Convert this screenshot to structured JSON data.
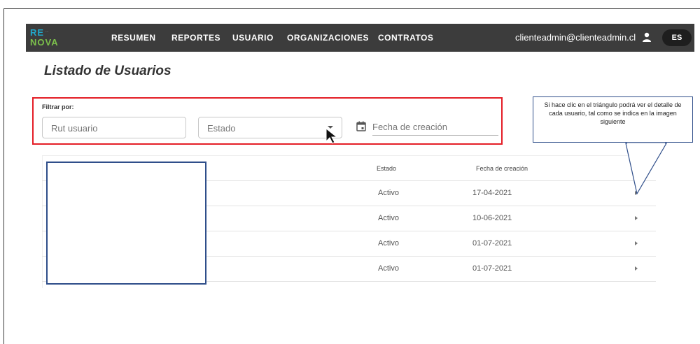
{
  "app": {
    "logo_top": "RE",
    "logo_top_small": "...",
    "logo_bottom": "NOVA"
  },
  "nav": {
    "items": [
      "RESUMEN",
      "REPORTES",
      "USUARIO",
      "ORGANIZACIONES",
      "CONTRATOS"
    ],
    "user_email": "clienteadmin@clienteadmin.cl",
    "user_icon": "person-icon",
    "language": "ES"
  },
  "page": {
    "title": "Listado de Usuarios"
  },
  "filters": {
    "label": "Filtrar por:",
    "rut_placeholder": "Rut usuario",
    "estado_placeholder": "Estado",
    "fecha_placeholder": "Fecha de creación",
    "calendar_icon": "calendar-icon"
  },
  "table": {
    "headers": {
      "estado": "Estado",
      "fecha": "Fecha de creación"
    },
    "rows": [
      {
        "estado": "Activo",
        "fecha": "17-04-2021"
      },
      {
        "estado": "Activo",
        "fecha": "10-06-2021"
      },
      {
        "estado": "Activo",
        "fecha": "01-07-2021"
      },
      {
        "estado": "Activo",
        "fecha": "01-07-2021"
      }
    ]
  },
  "annotation": {
    "callout": "Si hace clic en el triángulo podrá ver el detalle de cada usuario, tal como se indica en la imagen siguiente"
  },
  "colors": {
    "topbar": "#3c3c3c",
    "highlight_red": "#e41e26",
    "annotation_blue": "#2f4e8a",
    "logo_blue": "#22a7c9",
    "logo_green": "#7cc04b"
  }
}
